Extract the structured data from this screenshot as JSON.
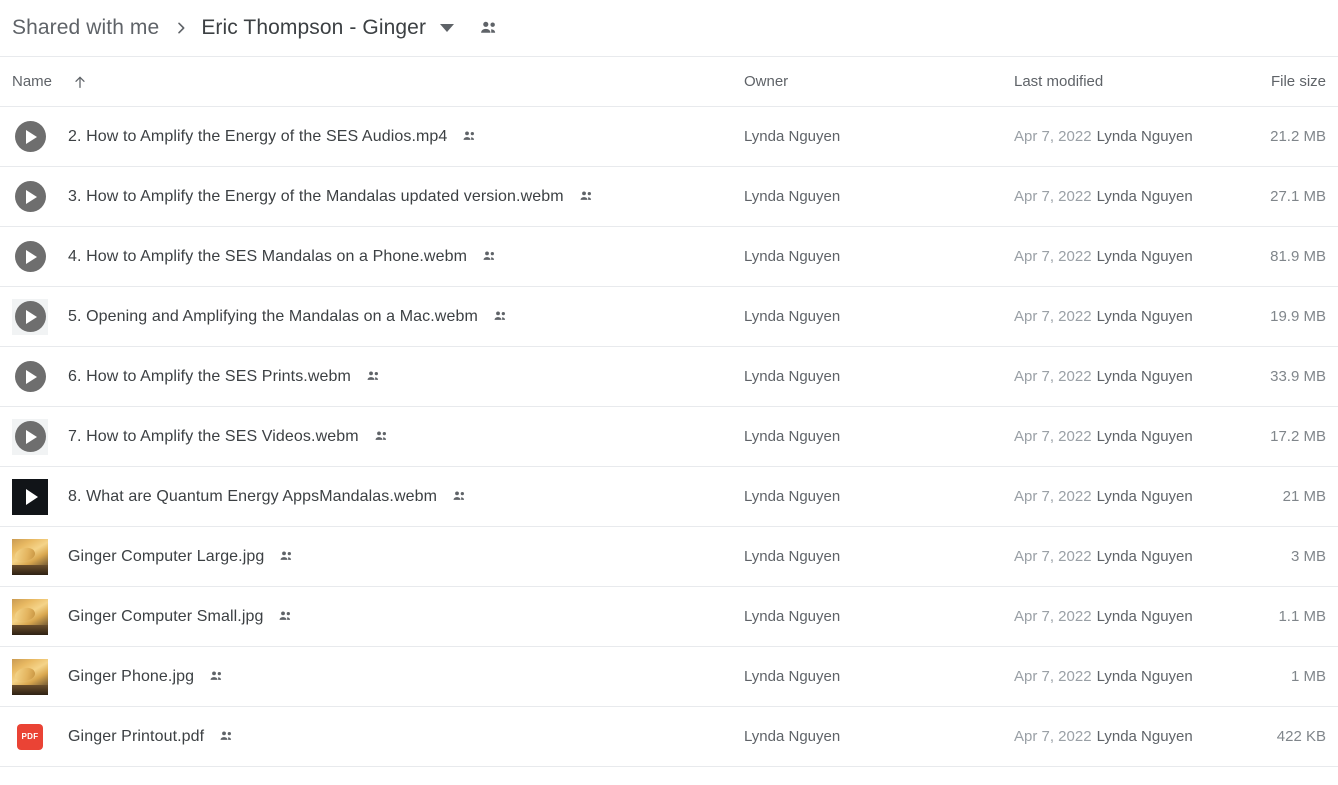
{
  "header": {
    "breadcrumb_root": "Shared with me",
    "breadcrumb_separator": "chevron-right-icon",
    "breadcrumb_current": "Eric Thompson - Ginger",
    "caret": "chevron-down-icon",
    "people_icon": "people-icon"
  },
  "columns": {
    "name": "Name",
    "sort_icon": "arrow-up-icon",
    "owner": "Owner",
    "last_modified": "Last modified",
    "file_size": "File size"
  },
  "colors": {
    "text_primary": "#3c4043",
    "text_secondary": "#5f6368",
    "text_muted": "#9aa0a6",
    "divider": "#e8eaed",
    "pdf_red": "#ea4335",
    "video_gray": "#6e6e6e"
  },
  "files": [
    {
      "name": "2. How to Amplify the Energy of the SES Audios.mp4",
      "icon": "video-play-icon",
      "shared": "people-icon",
      "owner": "Lynda Nguyen",
      "modified_date": "Apr 7, 2022",
      "modified_by": "Lynda Nguyen",
      "size": "21.2 MB"
    },
    {
      "name": "3. How to Amplify the Energy of the Mandalas updated version.webm",
      "icon": "video-play-icon",
      "shared": "people-icon",
      "owner": "Lynda Nguyen",
      "modified_date": "Apr 7, 2022",
      "modified_by": "Lynda Nguyen",
      "size": "27.1 MB"
    },
    {
      "name": "4. How to Amplify the SES Mandalas on a Phone.webm",
      "icon": "video-play-icon",
      "shared": "people-icon",
      "owner": "Lynda Nguyen",
      "modified_date": "Apr 7, 2022",
      "modified_by": "Lynda Nguyen",
      "size": "81.9 MB"
    },
    {
      "name": "5. Opening and Amplifying the Mandalas on a Mac.webm",
      "icon": "video-play-icon-light-thumb",
      "shared": "people-icon",
      "owner": "Lynda Nguyen",
      "modified_date": "Apr 7, 2022",
      "modified_by": "Lynda Nguyen",
      "size": "19.9 MB"
    },
    {
      "name": "6. How to Amplify the SES Prints.webm",
      "icon": "video-play-icon",
      "shared": "people-icon",
      "owner": "Lynda Nguyen",
      "modified_date": "Apr 7, 2022",
      "modified_by": "Lynda Nguyen",
      "size": "33.9 MB"
    },
    {
      "name": "7. How to Amplify the SES Videos.webm",
      "icon": "video-play-icon-light-thumb",
      "shared": "people-icon",
      "owner": "Lynda Nguyen",
      "modified_date": "Apr 7, 2022",
      "modified_by": "Lynda Nguyen",
      "size": "17.2 MB"
    },
    {
      "name": "8. What are Quantum Energy AppsMandalas.webm",
      "icon": "video-dark-thumbnail-icon",
      "shared": "people-icon",
      "owner": "Lynda Nguyen",
      "modified_date": "Apr 7, 2022",
      "modified_by": "Lynda Nguyen",
      "size": "21 MB"
    },
    {
      "name": "Ginger Computer Large.jpg",
      "icon": "image-thumbnail-icon",
      "shared": "people-icon",
      "owner": "Lynda Nguyen",
      "modified_date": "Apr 7, 2022",
      "modified_by": "Lynda Nguyen",
      "size": "3 MB"
    },
    {
      "name": "Ginger Computer Small.jpg",
      "icon": "image-thumbnail-icon",
      "shared": "people-icon",
      "owner": "Lynda Nguyen",
      "modified_date": "Apr 7, 2022",
      "modified_by": "Lynda Nguyen",
      "size": "1.1 MB"
    },
    {
      "name": "Ginger Phone.jpg",
      "icon": "image-thumbnail-icon",
      "shared": "people-icon",
      "owner": "Lynda Nguyen",
      "modified_date": "Apr 7, 2022",
      "modified_by": "Lynda Nguyen",
      "size": "1 MB"
    },
    {
      "name": "Ginger Printout.pdf",
      "icon": "pdf-icon",
      "icon_label": "PDF",
      "shared": "people-icon",
      "owner": "Lynda Nguyen",
      "modified_date": "Apr 7, 2022",
      "modified_by": "Lynda Nguyen",
      "size": "422 KB"
    }
  ]
}
